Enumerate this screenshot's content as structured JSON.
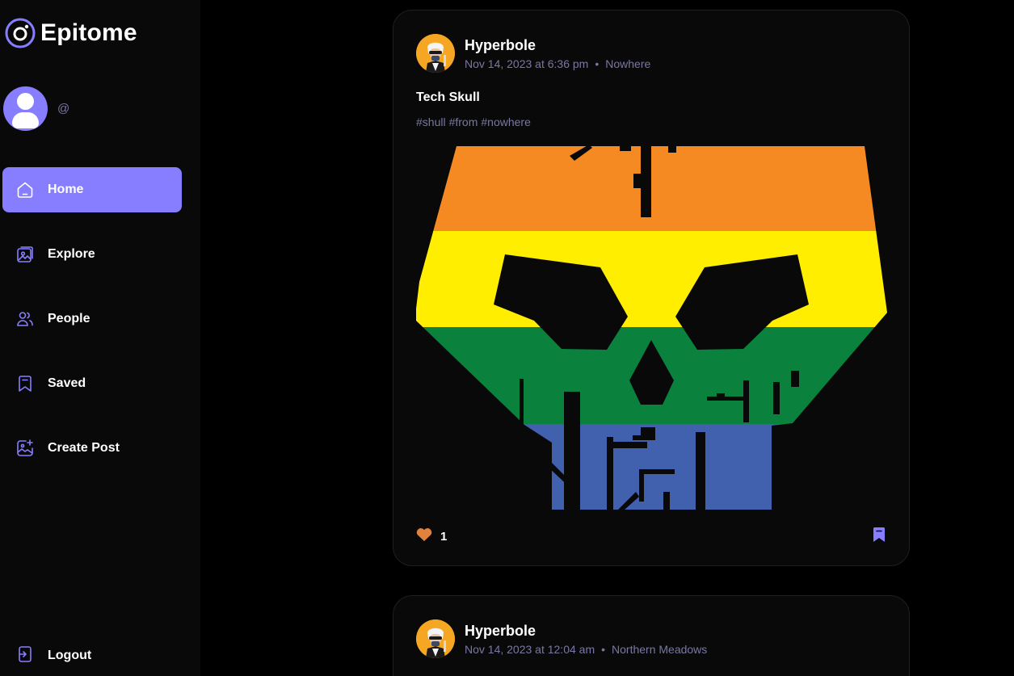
{
  "app": {
    "name": "Epitome"
  },
  "profile": {
    "handle": "@"
  },
  "nav": {
    "items": [
      {
        "label": "Home",
        "icon": "home-icon",
        "active": true
      },
      {
        "label": "Explore",
        "icon": "gallery-icon",
        "active": false
      },
      {
        "label": "People",
        "icon": "people-icon",
        "active": false
      },
      {
        "label": "Saved",
        "icon": "bookmark-icon",
        "active": false
      },
      {
        "label": "Create Post",
        "icon": "add-image-icon",
        "active": false
      }
    ],
    "logout_label": "Logout"
  },
  "posts": [
    {
      "author": "Hyperbole",
      "date": "Nov 14, 2023 at 6:36 pm",
      "location": "Nowhere",
      "caption": "Tech Skull",
      "tags": [
        "#shull",
        "#from",
        "#nowhere"
      ],
      "likes": "1",
      "liked": true
    },
    {
      "author": "Hyperbole",
      "date": "Nov 14, 2023 at 12:04 am",
      "location": "Northern Meadows"
    }
  ],
  "colors": {
    "accent": "#877eff",
    "background": "#000000",
    "card": "#09090a",
    "muted_text": "#7878a3",
    "like": "#e0823d",
    "pride_orange": "#f58a23",
    "pride_yellow": "#ffee00",
    "pride_green": "#0a813c",
    "pride_blue": "#4160ae"
  }
}
